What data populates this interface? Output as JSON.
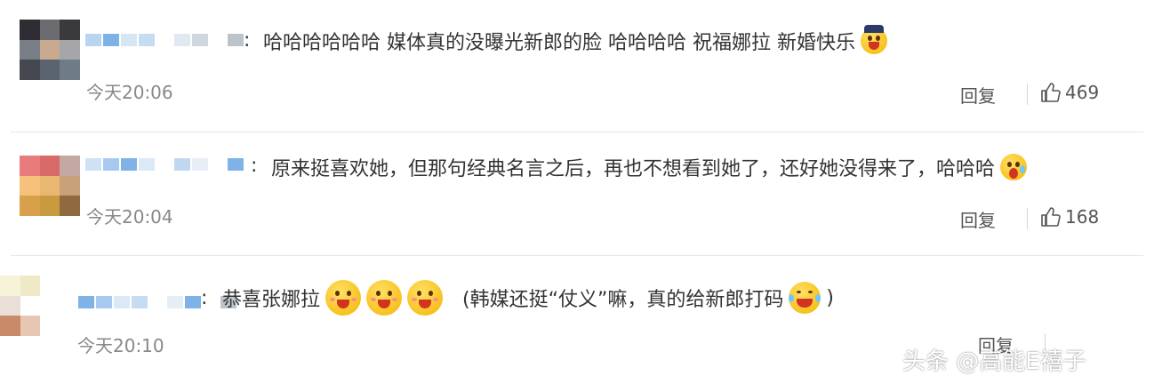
{
  "comments": [
    {
      "separator": ":",
      "text_parts": [
        "哈哈哈哈哈哈 媒体真的没曝光新郎的脸 哈哈哈哈 祝福娜拉 新婚快乐"
      ],
      "emoji": "party-face-emoji",
      "time": "今天20:06",
      "reply_label": "回复",
      "likes": "469",
      "avatar_colors": [
        "#2d2d33",
        "#6b6b70",
        "#3a3a3d",
        "#7a7e86",
        "#c9a98f",
        "#a5a6aa",
        "#45484f",
        "#5a6370",
        "#6e7c85"
      ],
      "name_colors": [
        "#b9d4f0",
        "#7fb3e8",
        "#d6e6f5",
        "#c5dcf1",
        "#ffffff",
        "#e0e8f2",
        "#d0d7df",
        "#ffffff",
        "#bcc3cb"
      ]
    },
    {
      "separator": ":",
      "text_parts": [
        "原来挺喜欢她，但那句经典名言之后，再也不想看到她了，还好她没得来了，哈哈哈"
      ],
      "emoji": "scared-face-emoji",
      "time": "今天20:04",
      "reply_label": "回复",
      "likes": "168",
      "avatar_colors": [
        "#e87b7b",
        "#d96a6a",
        "#c4a9a3",
        "#f5c17b",
        "#e8b873",
        "#c8a07a",
        "#d9a04b",
        "#c99a3e",
        "#8f6a3f"
      ],
      "name_colors": [
        "#cfe2f5",
        "#a7c9ef",
        "#7fb3e8",
        "#dbe9f7",
        "#ffffff",
        "#c0d7f0",
        "#e8eef5",
        "#ffffff",
        "#7fb3e8"
      ]
    },
    {
      "separator": ":",
      "text_parts": [
        "恭喜张娜拉",
        "(韩媒还挺“仗义”嘛，真的给新郎打码",
        ")"
      ],
      "emojis_first": [
        "love-face-emoji",
        "love-face-emoji",
        "love-face-emoji"
      ],
      "emoji_second": "laughing-tears-emoji",
      "time": "今天20:10",
      "reply_label": "回复",
      "likes": "",
      "avatar_colors": [
        "#f7f3d9",
        "#efe9c8",
        "#ffffff",
        "#eadfd8",
        "#ffffff",
        "#ffffff",
        "#c98a6a",
        "#e7c6b4",
        "#ffffff"
      ],
      "name_colors": [
        "#7fb3e8",
        "#a7c9ef",
        "#dbe9f7",
        "#c5dcf1",
        "#ffffff",
        "#e6edf4",
        "#7fb3e8",
        "#ffffff",
        "#bcc3cb"
      ]
    }
  ],
  "watermark": "头条 @高能E禧子"
}
